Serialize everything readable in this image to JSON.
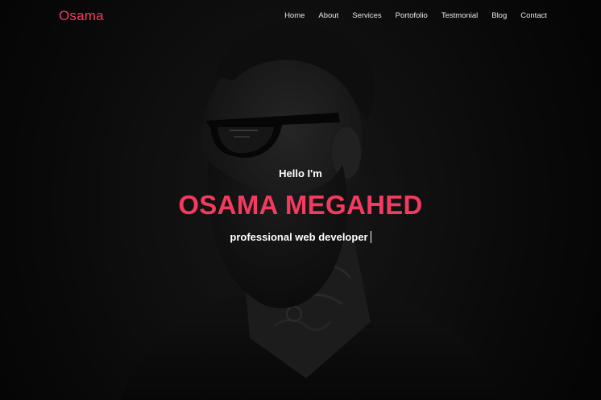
{
  "brand": {
    "name": "Osama"
  },
  "nav": {
    "items": [
      "Home",
      "About",
      "Services",
      "Portofolio",
      "Testmonial",
      "Blog",
      "Contact"
    ]
  },
  "hero": {
    "greeting": "Hello I'm",
    "name": "OSAMA MEGAHED",
    "role": "professional web developer"
  },
  "colors": {
    "accent": "#f33a5f",
    "background": "#0d0d0d",
    "text": "#ffffff"
  },
  "icons": [
    "text-cursor-icon"
  ]
}
